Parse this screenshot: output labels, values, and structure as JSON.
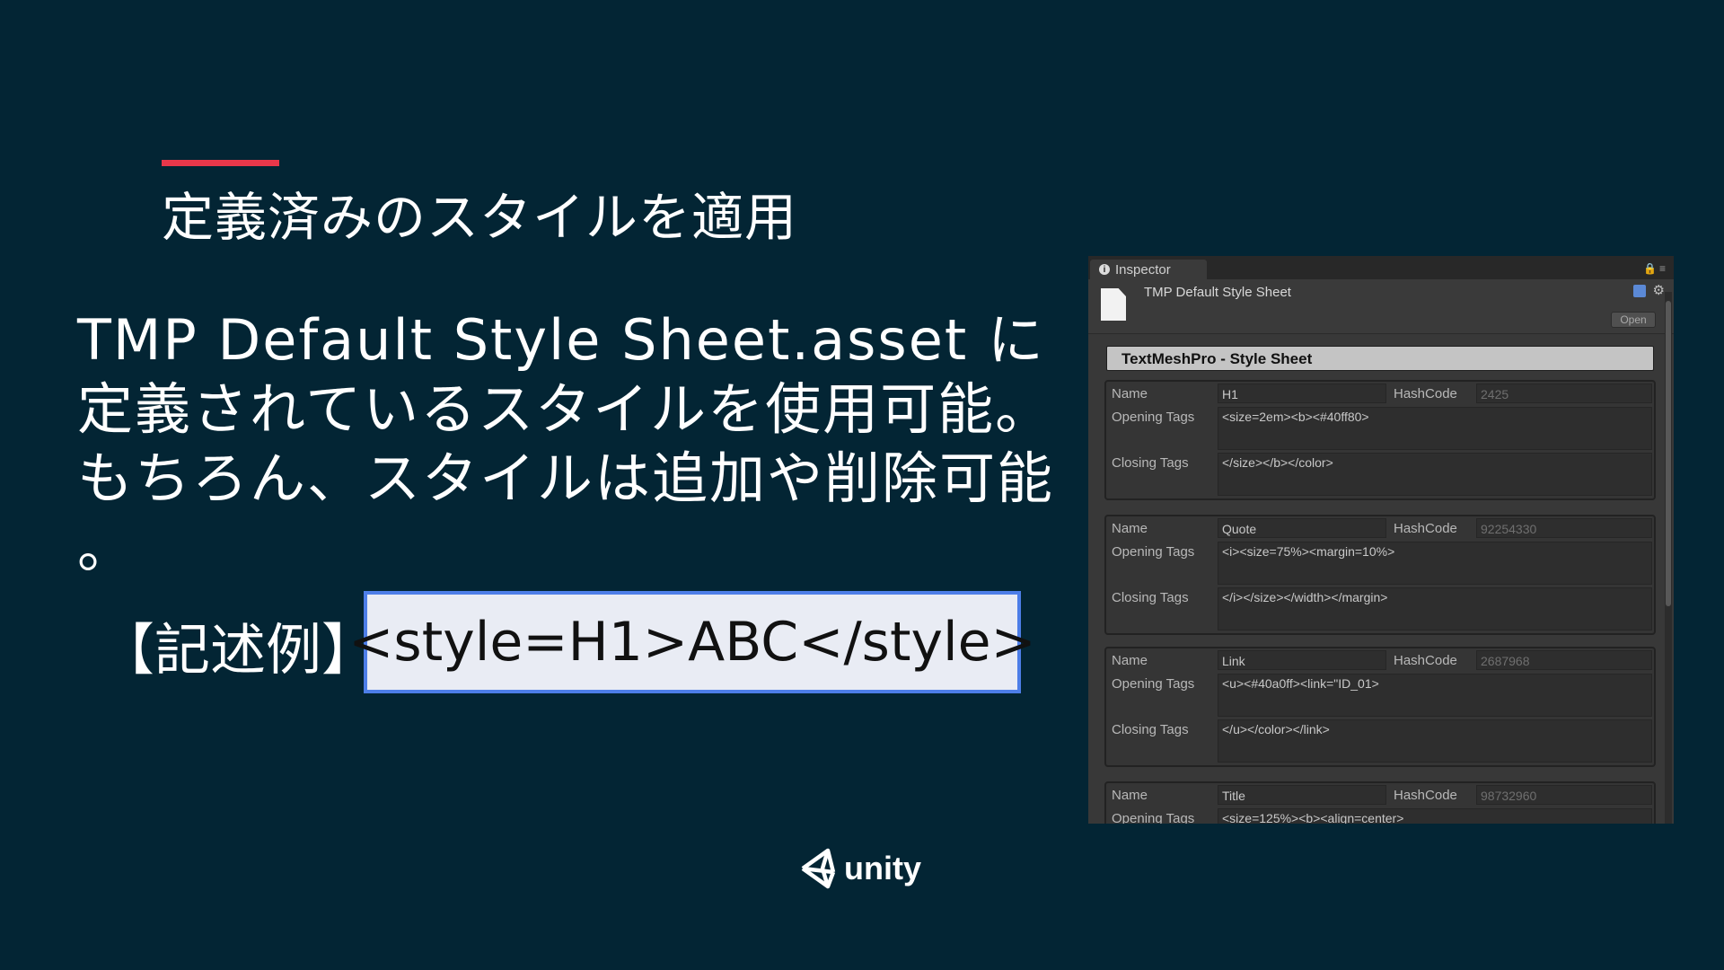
{
  "slide": {
    "title": "定義済みのスタイルを適用",
    "body_lines": [
      "TMP Default Style Sheet.asset に",
      "定義されているスタイルを使用可能。",
      "もちろん、スタイルは追加や削除可能",
      "。"
    ],
    "example_label": "【記述例】",
    "example_code": "<style=H1>ABC</style>",
    "accent_color": "#e8374a",
    "background_color": "#032534",
    "code_border_color": "#4d7ee8"
  },
  "inspector": {
    "tab_label": "Inspector",
    "asset_name": "TMP Default Style Sheet",
    "open_button": "Open",
    "section_title": "TextMeshPro - Style Sheet",
    "labels": {
      "name": "Name",
      "hashcode": "HashCode",
      "opening": "Opening Tags",
      "closing": "Closing Tags"
    },
    "styles": [
      {
        "name": "H1",
        "hashcode": "2425",
        "opening": "<size=2em><b><#40ff80>",
        "closing": "</size></b></color>"
      },
      {
        "name": "Quote",
        "hashcode": "92254330",
        "opening": "<i><size=75%><margin=10%>",
        "closing": "</i></size></width></margin>"
      },
      {
        "name": "Link",
        "hashcode": "2687968",
        "opening": "<u><#40a0ff><link=\"ID_01>",
        "closing": "</u></color></link>"
      },
      {
        "name": "Title",
        "hashcode": "98732960",
        "opening": "<size=125%><b><align=center>",
        "closing": ""
      }
    ]
  },
  "logo": {
    "text": "unity"
  },
  "icons": [
    "info-icon",
    "lock-icon",
    "menu-icon",
    "document-icon",
    "book-icon",
    "gear-icon",
    "unity-logo-icon"
  ]
}
